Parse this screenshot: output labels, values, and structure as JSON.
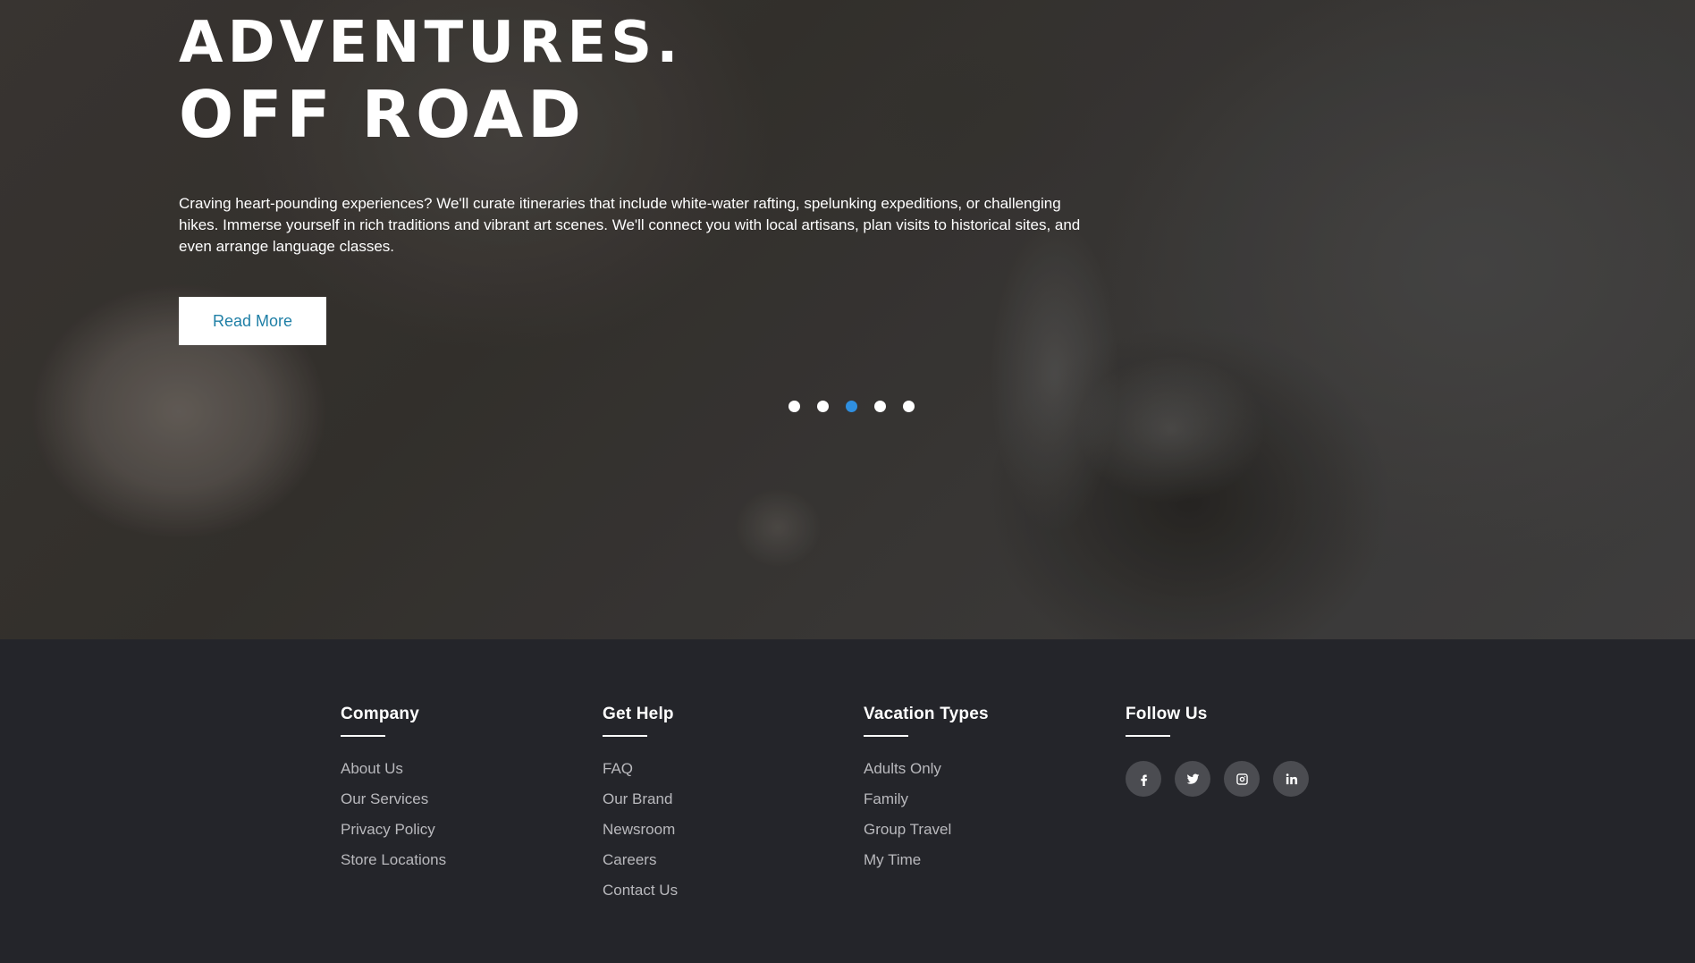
{
  "hero": {
    "title_line1": "ADVENTURES.",
    "title_line2": "OFF ROAD",
    "description": "Craving heart-pounding experiences? We'll curate itineraries that include white-water rafting, spelunking expeditions, or challenging hikes. Immerse yourself in rich traditions and vibrant art scenes. We'll connect you with local artisans, plan visits to historical sites, and even arrange language classes.",
    "button_label": "Read More",
    "slider": {
      "total": 5,
      "active_index": 3
    }
  },
  "footer": {
    "company": {
      "heading": "Company",
      "links": [
        "About Us",
        "Our Services",
        "Privacy Policy",
        "Store Locations"
      ]
    },
    "get_help": {
      "heading": "Get Help",
      "links": [
        "FAQ",
        "Our Brand",
        "Newsroom",
        "Careers",
        "Contact Us"
      ]
    },
    "vacation_types": {
      "heading": "Vacation Types",
      "links": [
        "Adults Only",
        "Family",
        "Group Travel",
        "My Time"
      ]
    },
    "follow_us": {
      "heading": "Follow Us",
      "social": [
        "facebook-icon",
        "twitter-icon",
        "instagram-icon",
        "linkedin-icon"
      ]
    }
  },
  "colors": {
    "footer_bg": "#24252a",
    "button_text": "#1f7fa6",
    "active_dot": "#2f8fe0",
    "social_bg": "#4b4c51"
  }
}
